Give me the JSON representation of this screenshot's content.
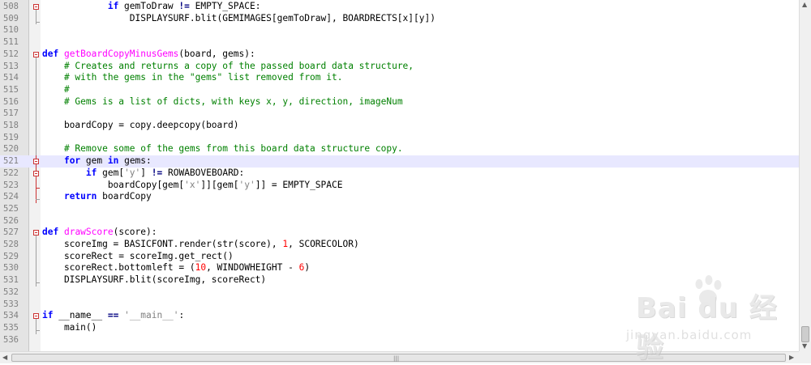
{
  "editor": {
    "current_line": 521,
    "lines": [
      {
        "n": "508",
        "segs": [
          {
            "t": "            "
          },
          {
            "t": "if",
            "c": "kw"
          },
          {
            "t": " gemToDraw "
          },
          {
            "t": "!=",
            "c": "op"
          },
          {
            "t": " EMPTY_SPACE:"
          }
        ]
      },
      {
        "n": "509",
        "segs": [
          {
            "t": "                DISPLAYSURF.blit(GEMIMAGES[gemToDraw], BOARDRECTS[x][y])"
          }
        ]
      },
      {
        "n": "510",
        "segs": []
      },
      {
        "n": "511",
        "segs": []
      },
      {
        "n": "512",
        "segs": [
          {
            "t": "def",
            "c": "kw"
          },
          {
            "t": " "
          },
          {
            "t": "getBoardCopyMinusGems",
            "c": "fn"
          },
          {
            "t": "(board, gems):"
          }
        ]
      },
      {
        "n": "513",
        "segs": [
          {
            "t": "    "
          },
          {
            "t": "# Creates and returns a copy of the passed board data structure,",
            "c": "cm"
          }
        ]
      },
      {
        "n": "514",
        "segs": [
          {
            "t": "    "
          },
          {
            "t": "# with the gems in the \"gems\" list removed from it.",
            "c": "cm"
          }
        ]
      },
      {
        "n": "515",
        "segs": [
          {
            "t": "    "
          },
          {
            "t": "#",
            "c": "cm"
          }
        ]
      },
      {
        "n": "516",
        "segs": [
          {
            "t": "    "
          },
          {
            "t": "# Gems is a list of dicts, with keys x, y, direction, imageNum",
            "c": "cm"
          }
        ]
      },
      {
        "n": "517",
        "segs": []
      },
      {
        "n": "518",
        "segs": [
          {
            "t": "    boardCopy = copy.deepcopy(board)"
          }
        ]
      },
      {
        "n": "519",
        "segs": []
      },
      {
        "n": "520",
        "segs": [
          {
            "t": "    "
          },
          {
            "t": "# Remove some of the gems from this board data structure copy.",
            "c": "cm"
          }
        ]
      },
      {
        "n": "521",
        "segs": [
          {
            "t": "    "
          },
          {
            "t": "for",
            "c": "kw"
          },
          {
            "t": " gem "
          },
          {
            "t": "in",
            "c": "kw"
          },
          {
            "t": " gems:"
          }
        ]
      },
      {
        "n": "522",
        "segs": [
          {
            "t": "        "
          },
          {
            "t": "if",
            "c": "kw"
          },
          {
            "t": " gem["
          },
          {
            "t": "'y'",
            "c": "str"
          },
          {
            "t": "] "
          },
          {
            "t": "!=",
            "c": "op"
          },
          {
            "t": " ROWABOVEBOARD:"
          }
        ]
      },
      {
        "n": "523",
        "segs": [
          {
            "t": "            boardCopy[gem["
          },
          {
            "t": "'x'",
            "c": "str"
          },
          {
            "t": "]][gem["
          },
          {
            "t": "'y'",
            "c": "str"
          },
          {
            "t": "]] = EMPTY_SPACE"
          }
        ]
      },
      {
        "n": "524",
        "segs": [
          {
            "t": "    "
          },
          {
            "t": "return",
            "c": "kw"
          },
          {
            "t": " boardCopy"
          }
        ]
      },
      {
        "n": "525",
        "segs": []
      },
      {
        "n": "526",
        "segs": []
      },
      {
        "n": "527",
        "segs": [
          {
            "t": "def",
            "c": "kw"
          },
          {
            "t": " "
          },
          {
            "t": "drawScore",
            "c": "fn"
          },
          {
            "t": "(score):"
          }
        ]
      },
      {
        "n": "528",
        "segs": [
          {
            "t": "    scoreImg = BASICFONT.render(str(score), "
          },
          {
            "t": "1",
            "c": "num"
          },
          {
            "t": ", SCORECOLOR)"
          }
        ]
      },
      {
        "n": "529",
        "segs": [
          {
            "t": "    scoreRect = scoreImg.get_rect()"
          }
        ]
      },
      {
        "n": "530",
        "segs": [
          {
            "t": "    scoreRect.bottomleft = ("
          },
          {
            "t": "10",
            "c": "num"
          },
          {
            "t": ", WINDOWHEIGHT - "
          },
          {
            "t": "6",
            "c": "num"
          },
          {
            "t": ")"
          }
        ]
      },
      {
        "n": "531",
        "segs": [
          {
            "t": "    DISPLAYSURF.blit(scoreImg, scoreRect)"
          }
        ]
      },
      {
        "n": "532",
        "segs": []
      },
      {
        "n": "533",
        "segs": []
      },
      {
        "n": "534",
        "segs": [
          {
            "t": "if",
            "c": "kw"
          },
          {
            "t": " __name__ "
          },
          {
            "t": "==",
            "c": "op"
          },
          {
            "t": " "
          },
          {
            "t": "'__main__'",
            "c": "str"
          },
          {
            "t": ":"
          }
        ]
      },
      {
        "n": "535",
        "segs": [
          {
            "t": "    main()"
          }
        ]
      },
      {
        "n": "536",
        "segs": []
      }
    ]
  },
  "watermark": {
    "brand": "Bai du 经验",
    "url": "jingyan.baidu.com"
  },
  "scrollbar": {
    "h_grip": "|||"
  },
  "colors": {
    "keyword": "#0000ff",
    "function": "#ff00ff",
    "comment": "#008000",
    "string": "#808080",
    "number": "#ff0000",
    "current_line": "#e8e8ff",
    "fold_marker": "#cc3333"
  }
}
